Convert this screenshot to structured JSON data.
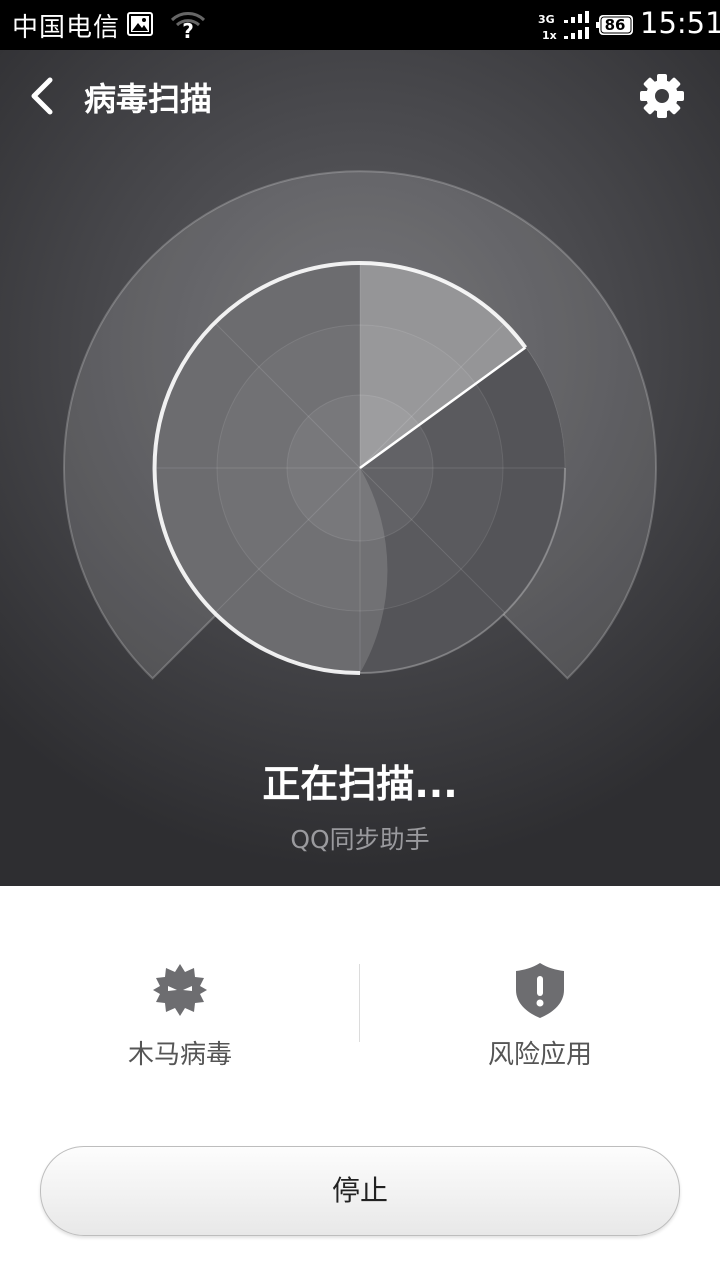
{
  "status_bar": {
    "carrier": "中国电信",
    "network_top": "3G",
    "network_bottom": "1x",
    "battery": "86",
    "time": "15:51"
  },
  "header": {
    "title": "病毒扫描",
    "back_icon": "chevron-left-icon",
    "settings_icon": "gear-icon"
  },
  "scan": {
    "status": "正在扫描...",
    "current_item": "QQ同步助手"
  },
  "categories": [
    {
      "label": "木马病毒",
      "icon": "virus-icon"
    },
    {
      "label": "风险应用",
      "icon": "shield-alert-icon"
    }
  ],
  "stop_button": {
    "label": "停止"
  },
  "colors": {
    "background_dark": "#3a3a3d",
    "accent_white": "#ffffff",
    "icon_gray": "#6d6d70"
  }
}
